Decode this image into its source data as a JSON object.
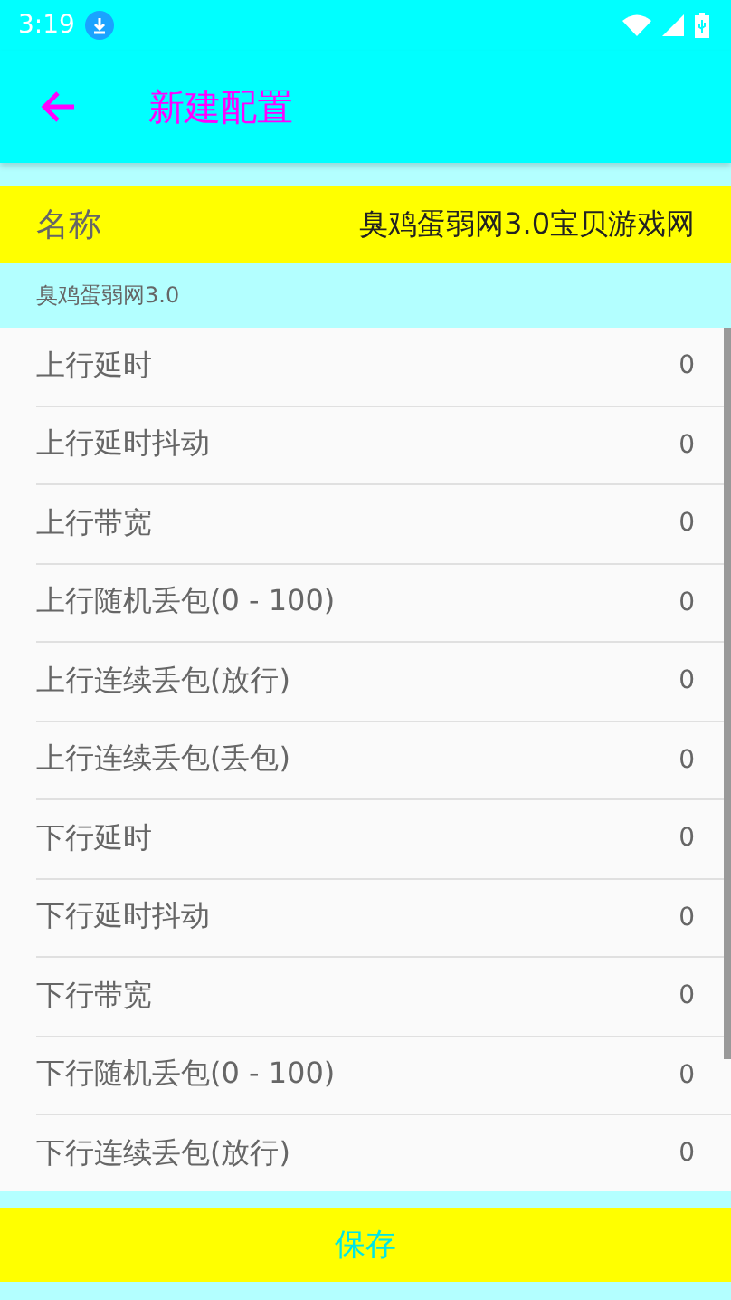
{
  "status_bar": {
    "time": "3:19"
  },
  "toolbar": {
    "title": "新建配置"
  },
  "name_field": {
    "label": "名称",
    "value": "臭鸡蛋弱网3.0宝贝游戏网"
  },
  "subtitle": "臭鸡蛋弱网3.0",
  "settings": [
    {
      "label": "上行延时",
      "value": "0"
    },
    {
      "label": "上行延时抖动",
      "value": "0"
    },
    {
      "label": "上行带宽",
      "value": "0"
    },
    {
      "label": "上行随机丢包(0 - 100)",
      "value": "0"
    },
    {
      "label": "上行连续丢包(放行)",
      "value": "0"
    },
    {
      "label": "上行连续丢包(丢包)",
      "value": "0"
    },
    {
      "label": "下行延时",
      "value": "0"
    },
    {
      "label": "下行延时抖动",
      "value": "0"
    },
    {
      "label": "下行带宽",
      "value": "0"
    },
    {
      "label": "下行随机丢包(0 - 100)",
      "value": "0"
    },
    {
      "label": "下行连续丢包(放行)",
      "value": "0"
    }
  ],
  "save_button": "保存"
}
